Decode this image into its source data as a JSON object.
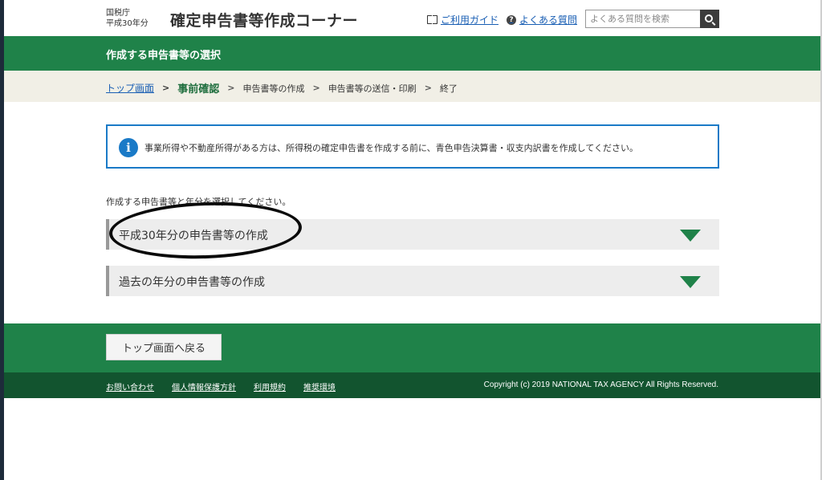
{
  "header": {
    "agency_line1": "国税庁",
    "agency_line2": "平成30年分",
    "site_title": "確定申告書等作成コーナー",
    "guide_link": "ご利用ガイド",
    "faq_link": "よくある質問",
    "search_placeholder": "よくある質問を検索"
  },
  "page_title": "作成する申告書等の選択",
  "steps": {
    "top": "トップ画面",
    "current": "事前確認",
    "s3": "申告書等の作成",
    "s4": "申告書等の送信・印刷",
    "s5": "終了"
  },
  "info_message": "事業所得や不動産所得がある方は、所得税の確定申告書を作成する前に、青色申告決算書・収支内訳書を作成してください。",
  "instruction": "作成する申告書等と年分を選択してください。",
  "accordions": [
    {
      "label": "平成30年分の申告書等の作成"
    },
    {
      "label": "過去の年分の申告書等の作成"
    }
  ],
  "footer": {
    "back_button": "トップ画面へ戻る",
    "links": [
      "お問い合わせ",
      "個人情報保護方針",
      "利用規約",
      "推奨環境"
    ],
    "copyright": "Copyright (c) 2019 NATIONAL TAX AGENCY All Rights Reserved."
  },
  "colors": {
    "primary_green": "#1f8249",
    "dark_green": "#12542f",
    "info_blue": "#1a7ac7",
    "step_bg": "#f1efe6"
  },
  "icons": [
    "book-icon",
    "question-icon",
    "search-icon",
    "info-icon",
    "triangle-down-icon"
  ]
}
